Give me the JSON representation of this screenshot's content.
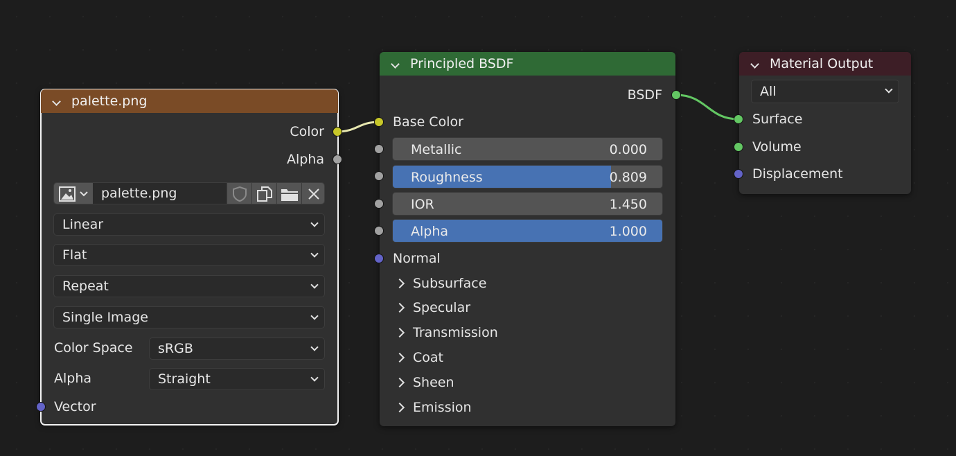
{
  "links_colors": {
    "color_link": "#e8e8b0",
    "bsdf_link": "#63c763"
  },
  "image_node": {
    "title": "palette.png",
    "header_color": "#7a4b26",
    "outputs": {
      "color": "Color",
      "alpha": "Alpha"
    },
    "image_name": "palette.png",
    "icons": [
      "image-browse-icon",
      "fake-user-shield-icon",
      "duplicate-icon",
      "open-folder-icon",
      "unlink-x-icon"
    ],
    "interpolation": "Linear",
    "projection": "Flat",
    "extension": "Repeat",
    "source": "Single Image",
    "color_space_label": "Color Space",
    "color_space_value": "sRGB",
    "alpha_label": "Alpha",
    "alpha_value": "Straight",
    "vector_label": "Vector"
  },
  "bsdf_node": {
    "title": "Principled BSDF",
    "header_color": "#2f6a35",
    "output": "BSDF",
    "base_color": "Base Color",
    "sliders": [
      {
        "name": "Metallic",
        "value": "0.000",
        "fraction": 0.0,
        "color": "#545454"
      },
      {
        "name": "Roughness",
        "value": "0.809",
        "fraction": 0.809,
        "color": "#4772b3"
      },
      {
        "name": "IOR",
        "value": "1.450",
        "fraction": 0.0,
        "color": "#545454"
      },
      {
        "name": "Alpha",
        "value": "1.000",
        "fraction": 1.0,
        "color": "#4772b3"
      }
    ],
    "normal": "Normal",
    "panels": [
      "Subsurface",
      "Specular",
      "Transmission",
      "Coat",
      "Sheen",
      "Emission"
    ]
  },
  "output_node": {
    "title": "Material Output",
    "header_color": "#3d1e26",
    "target": "All",
    "inputs": {
      "surface": "Surface",
      "volume": "Volume",
      "displacement": "Displacement"
    }
  }
}
